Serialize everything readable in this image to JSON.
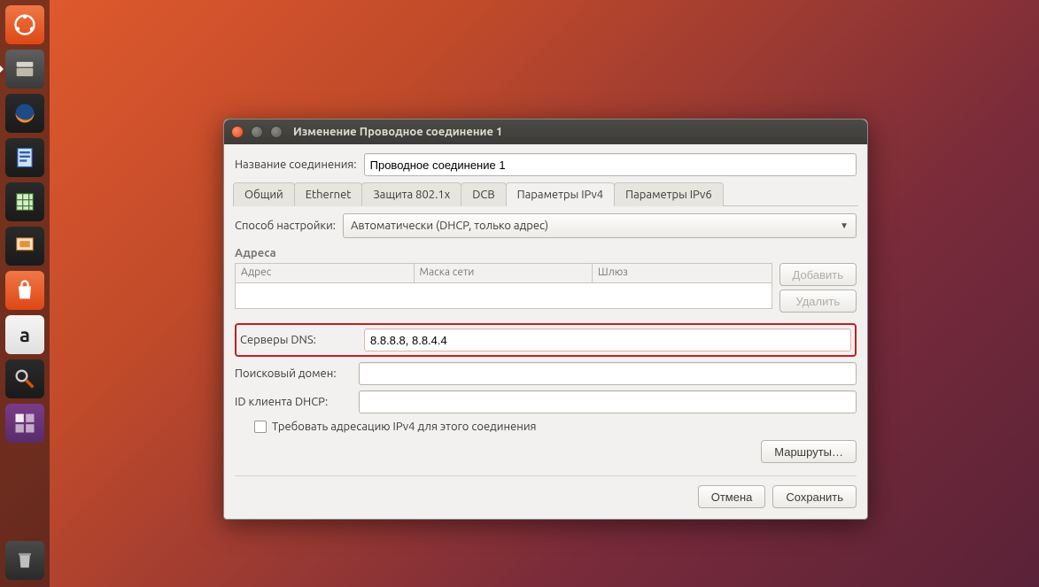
{
  "launcher": {
    "items": [
      {
        "name": "ubuntu-dash"
      },
      {
        "name": "files"
      },
      {
        "name": "firefox"
      },
      {
        "name": "libreoffice-writer"
      },
      {
        "name": "libreoffice-calc"
      },
      {
        "name": "libreoffice-impress"
      },
      {
        "name": "ubuntu-software"
      },
      {
        "name": "amazon"
      },
      {
        "name": "system-settings"
      },
      {
        "name": "workspace-switcher"
      },
      {
        "name": "trash"
      }
    ]
  },
  "window": {
    "title": "Изменение Проводное соединение 1",
    "name_label": "Название соединения:",
    "name_value": "Проводное соединение 1",
    "tabs": [
      "Общий",
      "Ethernet",
      "Защита 802.1x",
      "DCB",
      "Параметры IPv4",
      "Параметры IPv6"
    ],
    "active_tab_index": 4,
    "method_label": "Способ настройки:",
    "method_value": "Автоматически (DHCP, только адрес)",
    "addresses_section": "Адреса",
    "addresses_cols": [
      "Адрес",
      "Маска сети",
      "Шлюз"
    ],
    "btn_add": "Добавить",
    "btn_del": "Удалить",
    "dns_label": "Серверы DNS:",
    "dns_value": "8.8.8.8, 8.8.4.4",
    "search_label": "Поисковый домен:",
    "search_value": "",
    "dhcp_label": "ID клиента DHCP:",
    "dhcp_value": "",
    "require_label": "Требовать адресацию IPv4 для этого соединения",
    "routes_btn": "Маршруты…",
    "cancel_btn": "Отмена",
    "save_btn": "Сохранить"
  }
}
